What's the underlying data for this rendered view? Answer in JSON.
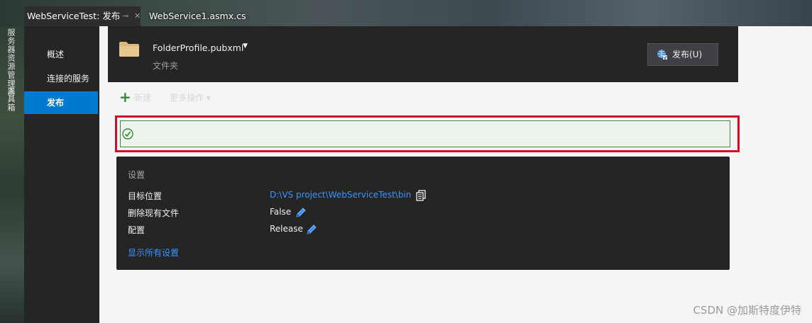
{
  "tabs": [
    {
      "label": "WebServiceTest: 发布",
      "pin": "⊸",
      "close": "✕"
    },
    {
      "label": "WebService1.asmx.cs"
    }
  ],
  "side_panels": [
    "服务器资源管理器",
    "工具箱"
  ],
  "nav": {
    "items": [
      {
        "label": "概述"
      },
      {
        "label": "连接的服务"
      },
      {
        "label": "发布"
      }
    ],
    "active_index": 2
  },
  "profile": {
    "name": "FolderProfile.pubxml",
    "caret": "▼",
    "type": "文件夹",
    "icon": "folder-icon",
    "publish_button": "发布(U)"
  },
  "actions": {
    "add_icon": "+",
    "add_label": "新建",
    "more_label": "更多操作 ▾"
  },
  "status": {
    "icon": "check-circle-icon",
    "message": ""
  },
  "settings": {
    "title": "设置",
    "rows": [
      {
        "label": "目标位置",
        "value": "D:\\VS project\\WebServiceTest\\bin"
      },
      {
        "label": "删除现有文件",
        "value": "False"
      },
      {
        "label": "配置",
        "value": "Release"
      }
    ],
    "show_all": "显示所有设置"
  },
  "watermark": "CSDN @加斯特度伊特",
  "colors": {
    "accent": "#007acc",
    "link": "#3794ff",
    "highlight_border": "#d0102a",
    "success_border": "#3a8a3a"
  }
}
